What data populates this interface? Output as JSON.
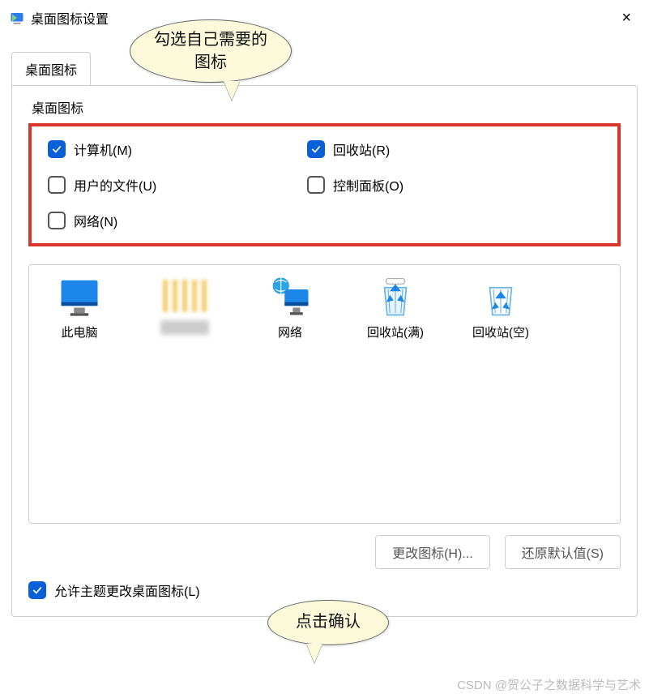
{
  "titlebar": {
    "title": "桌面图标设置",
    "close": "×"
  },
  "tab": {
    "label": "桌面图标"
  },
  "group": {
    "label": "桌面图标"
  },
  "checks": {
    "computer": {
      "label": "计算机(M)",
      "checked": true
    },
    "recyclebin": {
      "label": "回收站(R)",
      "checked": true
    },
    "userfiles": {
      "label": "用户的文件(U)",
      "checked": false
    },
    "controlpanel": {
      "label": "控制面板(O)",
      "checked": false
    },
    "network": {
      "label": "网络(N)",
      "checked": false
    }
  },
  "icons": {
    "thispc": {
      "label": "此电脑"
    },
    "blurred": {
      "label": ""
    },
    "network": {
      "label": "网络"
    },
    "recyclefull": {
      "label": "回收站(满)"
    },
    "recycleempty": {
      "label": "回收站(空)"
    }
  },
  "buttons": {
    "changeicon": "更改图标(H)...",
    "restoredefault": "还原默认值(S)"
  },
  "allow": {
    "label": "允许主题更改桌面图标(L)",
    "checked": true
  },
  "callouts": {
    "c1": "勾选自己需要的图标",
    "c2": "点击确认"
  },
  "watermark": "CSDN @贺公子之数据科学与艺术"
}
